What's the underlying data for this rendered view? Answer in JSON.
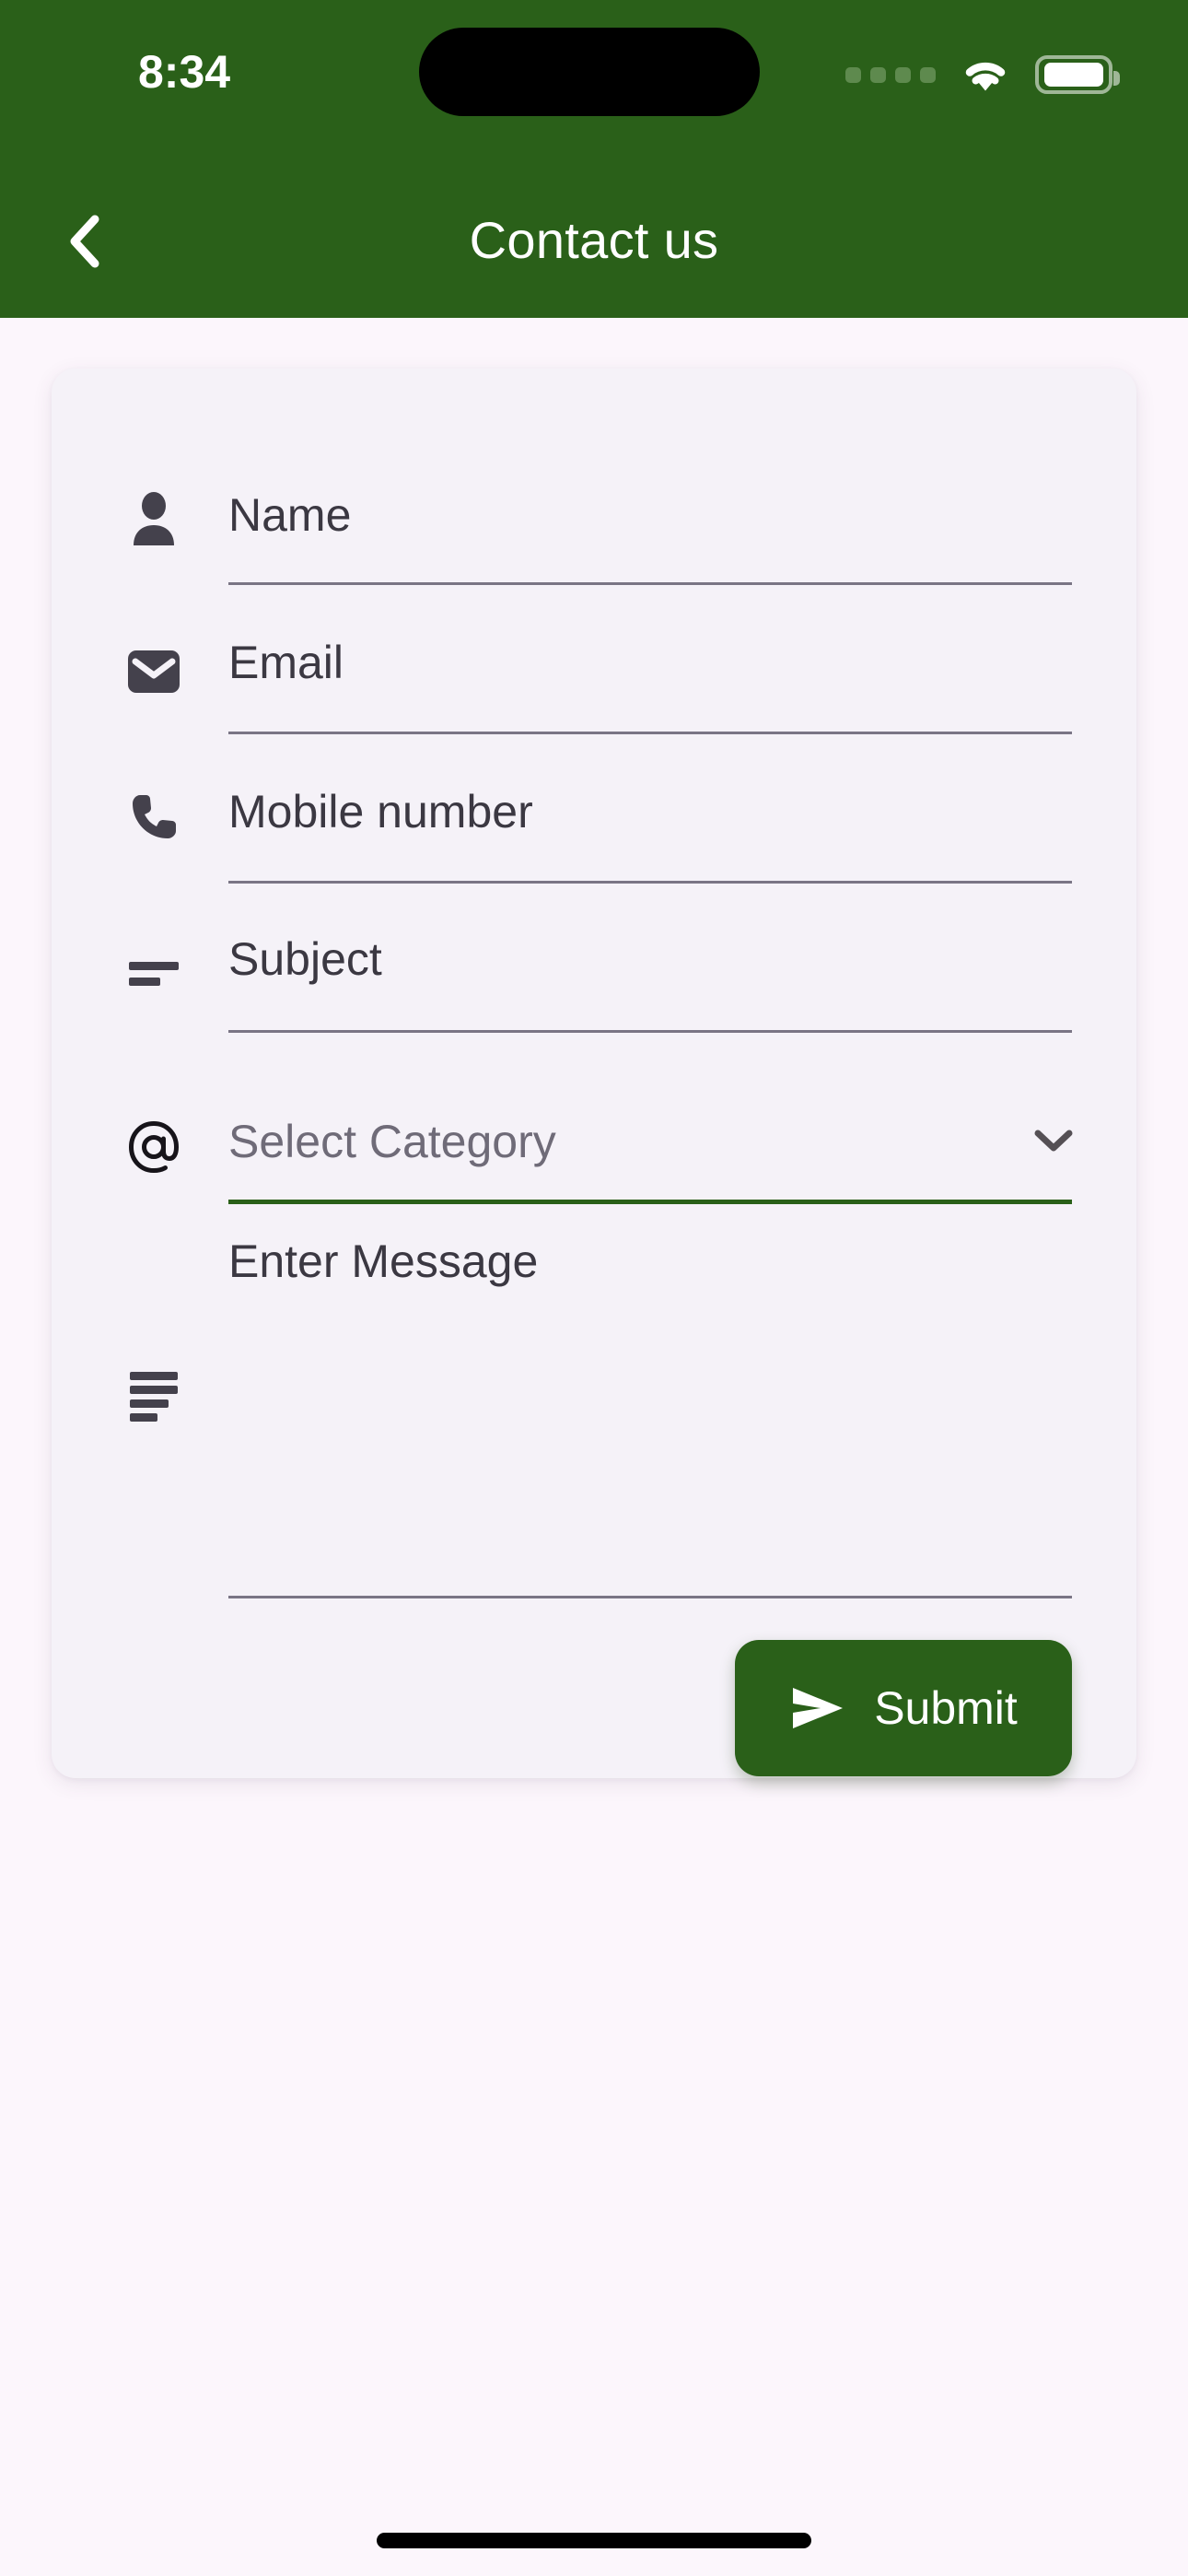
{
  "status_bar": {
    "time": "8:34",
    "signal_icon": "cellular-dots-icon",
    "wifi_icon": "wifi-icon",
    "battery_icon": "battery-full-icon"
  },
  "header": {
    "title": "Contact us",
    "back_icon": "chevron-left-icon"
  },
  "form": {
    "fields": [
      {
        "key": "name",
        "label": "Name",
        "icon": "person-icon",
        "state": "empty"
      },
      {
        "key": "email",
        "label": "Email",
        "icon": "mail-icon",
        "state": "empty"
      },
      {
        "key": "mobile",
        "label": "Mobile number",
        "icon": "phone-icon",
        "state": "empty"
      },
      {
        "key": "subject",
        "label": "Subject",
        "icon": "subject-icon",
        "state": "empty"
      },
      {
        "key": "category",
        "label": "Select Category",
        "icon": "at-sign-icon",
        "state": "active",
        "dropdown_icon": "chevron-down-icon"
      },
      {
        "key": "message",
        "label": "Enter Message",
        "icon": "notes-icon",
        "state": "empty"
      }
    ],
    "submit": {
      "label": "Submit",
      "icon": "send-icon"
    }
  },
  "colors": {
    "brand_green": "#2A6019",
    "page_background": "#FCF6FC",
    "card_background": "#F5F2F8",
    "field_underline": "#7A7585",
    "icon_dark": "#44414C",
    "placeholder_text": "#6F6B78",
    "label_text": "#3B3842"
  }
}
